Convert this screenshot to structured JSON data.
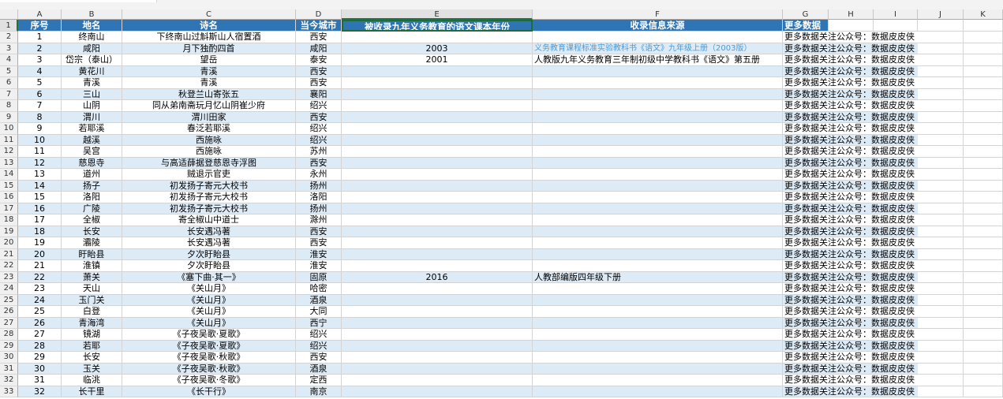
{
  "column_letters": [
    "A",
    "B",
    "C",
    "D",
    "E",
    "F",
    "G",
    "H",
    "I",
    "J",
    "K"
  ],
  "selected_column": "E",
  "header": {
    "seq": "序号",
    "place": "地名",
    "poem": "诗名",
    "city": "当今城市",
    "year": "被收录九年义务教育的语文课本年份",
    "source": "收录信息来源",
    "more": "更多数据"
  },
  "more_text": "更多数据关注公众号：数据皮皮侠",
  "rows": [
    {
      "n": "1",
      "seq": "1",
      "place": "终南山",
      "poem": "下终南山过斛斯山人宿置酒",
      "city": "西安",
      "year": "",
      "source": ""
    },
    {
      "n": "2",
      "seq": "2",
      "place": "咸阳",
      "poem": "月下独酌四首",
      "city": "咸阳",
      "year": "2003",
      "source": "义务教育课程标准实验教科书《语文》九年级上册（2003版）"
    },
    {
      "n": "3",
      "seq": "3",
      "place": "岱宗（泰山）",
      "poem": "望岳",
      "city": "泰安",
      "year": "2001",
      "source": "人教版九年义务教育三年制初级中学教科书《语文》第五册"
    },
    {
      "n": "4",
      "seq": "4",
      "place": "黄花川",
      "poem": "青溪",
      "city": "西安",
      "year": "",
      "source": ""
    },
    {
      "n": "5",
      "seq": "5",
      "place": "青溪",
      "poem": "青溪",
      "city": "西安",
      "year": "",
      "source": ""
    },
    {
      "n": "6",
      "seq": "6",
      "place": "三山",
      "poem": "秋登兰山寄张五",
      "city": "襄阳",
      "year": "",
      "source": ""
    },
    {
      "n": "7",
      "seq": "7",
      "place": "山阴",
      "poem": "同从弟南斋玩月忆山阴崔少府",
      "city": "绍兴",
      "year": "",
      "source": ""
    },
    {
      "n": "8",
      "seq": "8",
      "place": "渭川",
      "poem": "渭川田家",
      "city": "西安",
      "year": "",
      "source": ""
    },
    {
      "n": "9",
      "seq": "9",
      "place": "若耶溪",
      "poem": "春泛若耶溪",
      "city": "绍兴",
      "year": "",
      "source": ""
    },
    {
      "n": "10",
      "seq": "10",
      "place": "越溪",
      "poem": "西施咏",
      "city": "绍兴",
      "year": "",
      "source": ""
    },
    {
      "n": "11",
      "seq": "11",
      "place": "吴宫",
      "poem": "西施咏",
      "city": "苏州",
      "year": "",
      "source": ""
    },
    {
      "n": "12",
      "seq": "12",
      "place": "慈恩寺",
      "poem": "与高适薛据登慈恩寺浮图",
      "city": "西安",
      "year": "",
      "source": ""
    },
    {
      "n": "13",
      "seq": "13",
      "place": "道州",
      "poem": "贼退示官吏",
      "city": "永州",
      "year": "",
      "source": ""
    },
    {
      "n": "14",
      "seq": "14",
      "place": "扬子",
      "poem": "初发扬子寄元大校书",
      "city": "扬州",
      "year": "",
      "source": ""
    },
    {
      "n": "15",
      "seq": "15",
      "place": "洛阳",
      "poem": "初发扬子寄元大校书",
      "city": "洛阳",
      "year": "",
      "source": ""
    },
    {
      "n": "16",
      "seq": "16",
      "place": "广陵",
      "poem": "初发扬子寄元大校书",
      "city": "扬州",
      "year": "",
      "source": ""
    },
    {
      "n": "17",
      "seq": "17",
      "place": "全椒",
      "poem": "寄全椒山中道士",
      "city": "滁州",
      "year": "",
      "source": ""
    },
    {
      "n": "18",
      "seq": "18",
      "place": "长安",
      "poem": "长安遇冯著",
      "city": "西安",
      "year": "",
      "source": ""
    },
    {
      "n": "19",
      "seq": "19",
      "place": "灞陵",
      "poem": "长安遇冯著",
      "city": "西安",
      "year": "",
      "source": ""
    },
    {
      "n": "20",
      "seq": "20",
      "place": "盱眙县",
      "poem": "夕次盱眙县",
      "city": "淮安",
      "year": "",
      "source": ""
    },
    {
      "n": "21",
      "seq": "21",
      "place": "淮镇",
      "poem": "夕次盱眙县",
      "city": "淮安",
      "year": "",
      "source": ""
    },
    {
      "n": "22",
      "seq": "22",
      "place": "萧关",
      "poem": "《塞下曲·其一》",
      "city": "固原",
      "year": "2016",
      "source": "人教部编版四年级下册"
    },
    {
      "n": "23",
      "seq": "23",
      "place": "天山",
      "poem": "《关山月》",
      "city": "哈密",
      "year": "",
      "source": ""
    },
    {
      "n": "24",
      "seq": "24",
      "place": "玉门关",
      "poem": "《关山月》",
      "city": "酒泉",
      "year": "",
      "source": ""
    },
    {
      "n": "25",
      "seq": "25",
      "place": "白登",
      "poem": "《关山月》",
      "city": "大同",
      "year": "",
      "source": ""
    },
    {
      "n": "26",
      "seq": "26",
      "place": "青海湾",
      "poem": "《关山月》",
      "city": "西宁",
      "year": "",
      "source": ""
    },
    {
      "n": "27",
      "seq": "27",
      "place": "镜湖",
      "poem": "《子夜吴歌·夏歌》",
      "city": "绍兴",
      "year": "",
      "source": ""
    },
    {
      "n": "28",
      "seq": "28",
      "place": "若耶",
      "poem": "《子夜吴歌·夏歌》",
      "city": "绍兴",
      "year": "",
      "source": ""
    },
    {
      "n": "29",
      "seq": "29",
      "place": "长安",
      "poem": "《子夜吴歌·秋歌》",
      "city": "西安",
      "year": "",
      "source": ""
    },
    {
      "n": "30",
      "seq": "30",
      "place": "玉关",
      "poem": "《子夜吴歌·秋歌》",
      "city": "酒泉",
      "year": "",
      "source": ""
    },
    {
      "n": "31",
      "seq": "31",
      "place": "临洮",
      "poem": "《子夜吴歌·冬歌》",
      "city": "定西",
      "year": "",
      "source": ""
    },
    {
      "n": "32",
      "seq": "32",
      "place": "长干里",
      "poem": "《长干行》",
      "city": "南京",
      "year": "",
      "source": ""
    }
  ],
  "colors": {
    "header_bg": "#2f75b5",
    "band_bg": "#ddebf7",
    "link_text": "#4a9bd6",
    "selection": "#217346"
  }
}
